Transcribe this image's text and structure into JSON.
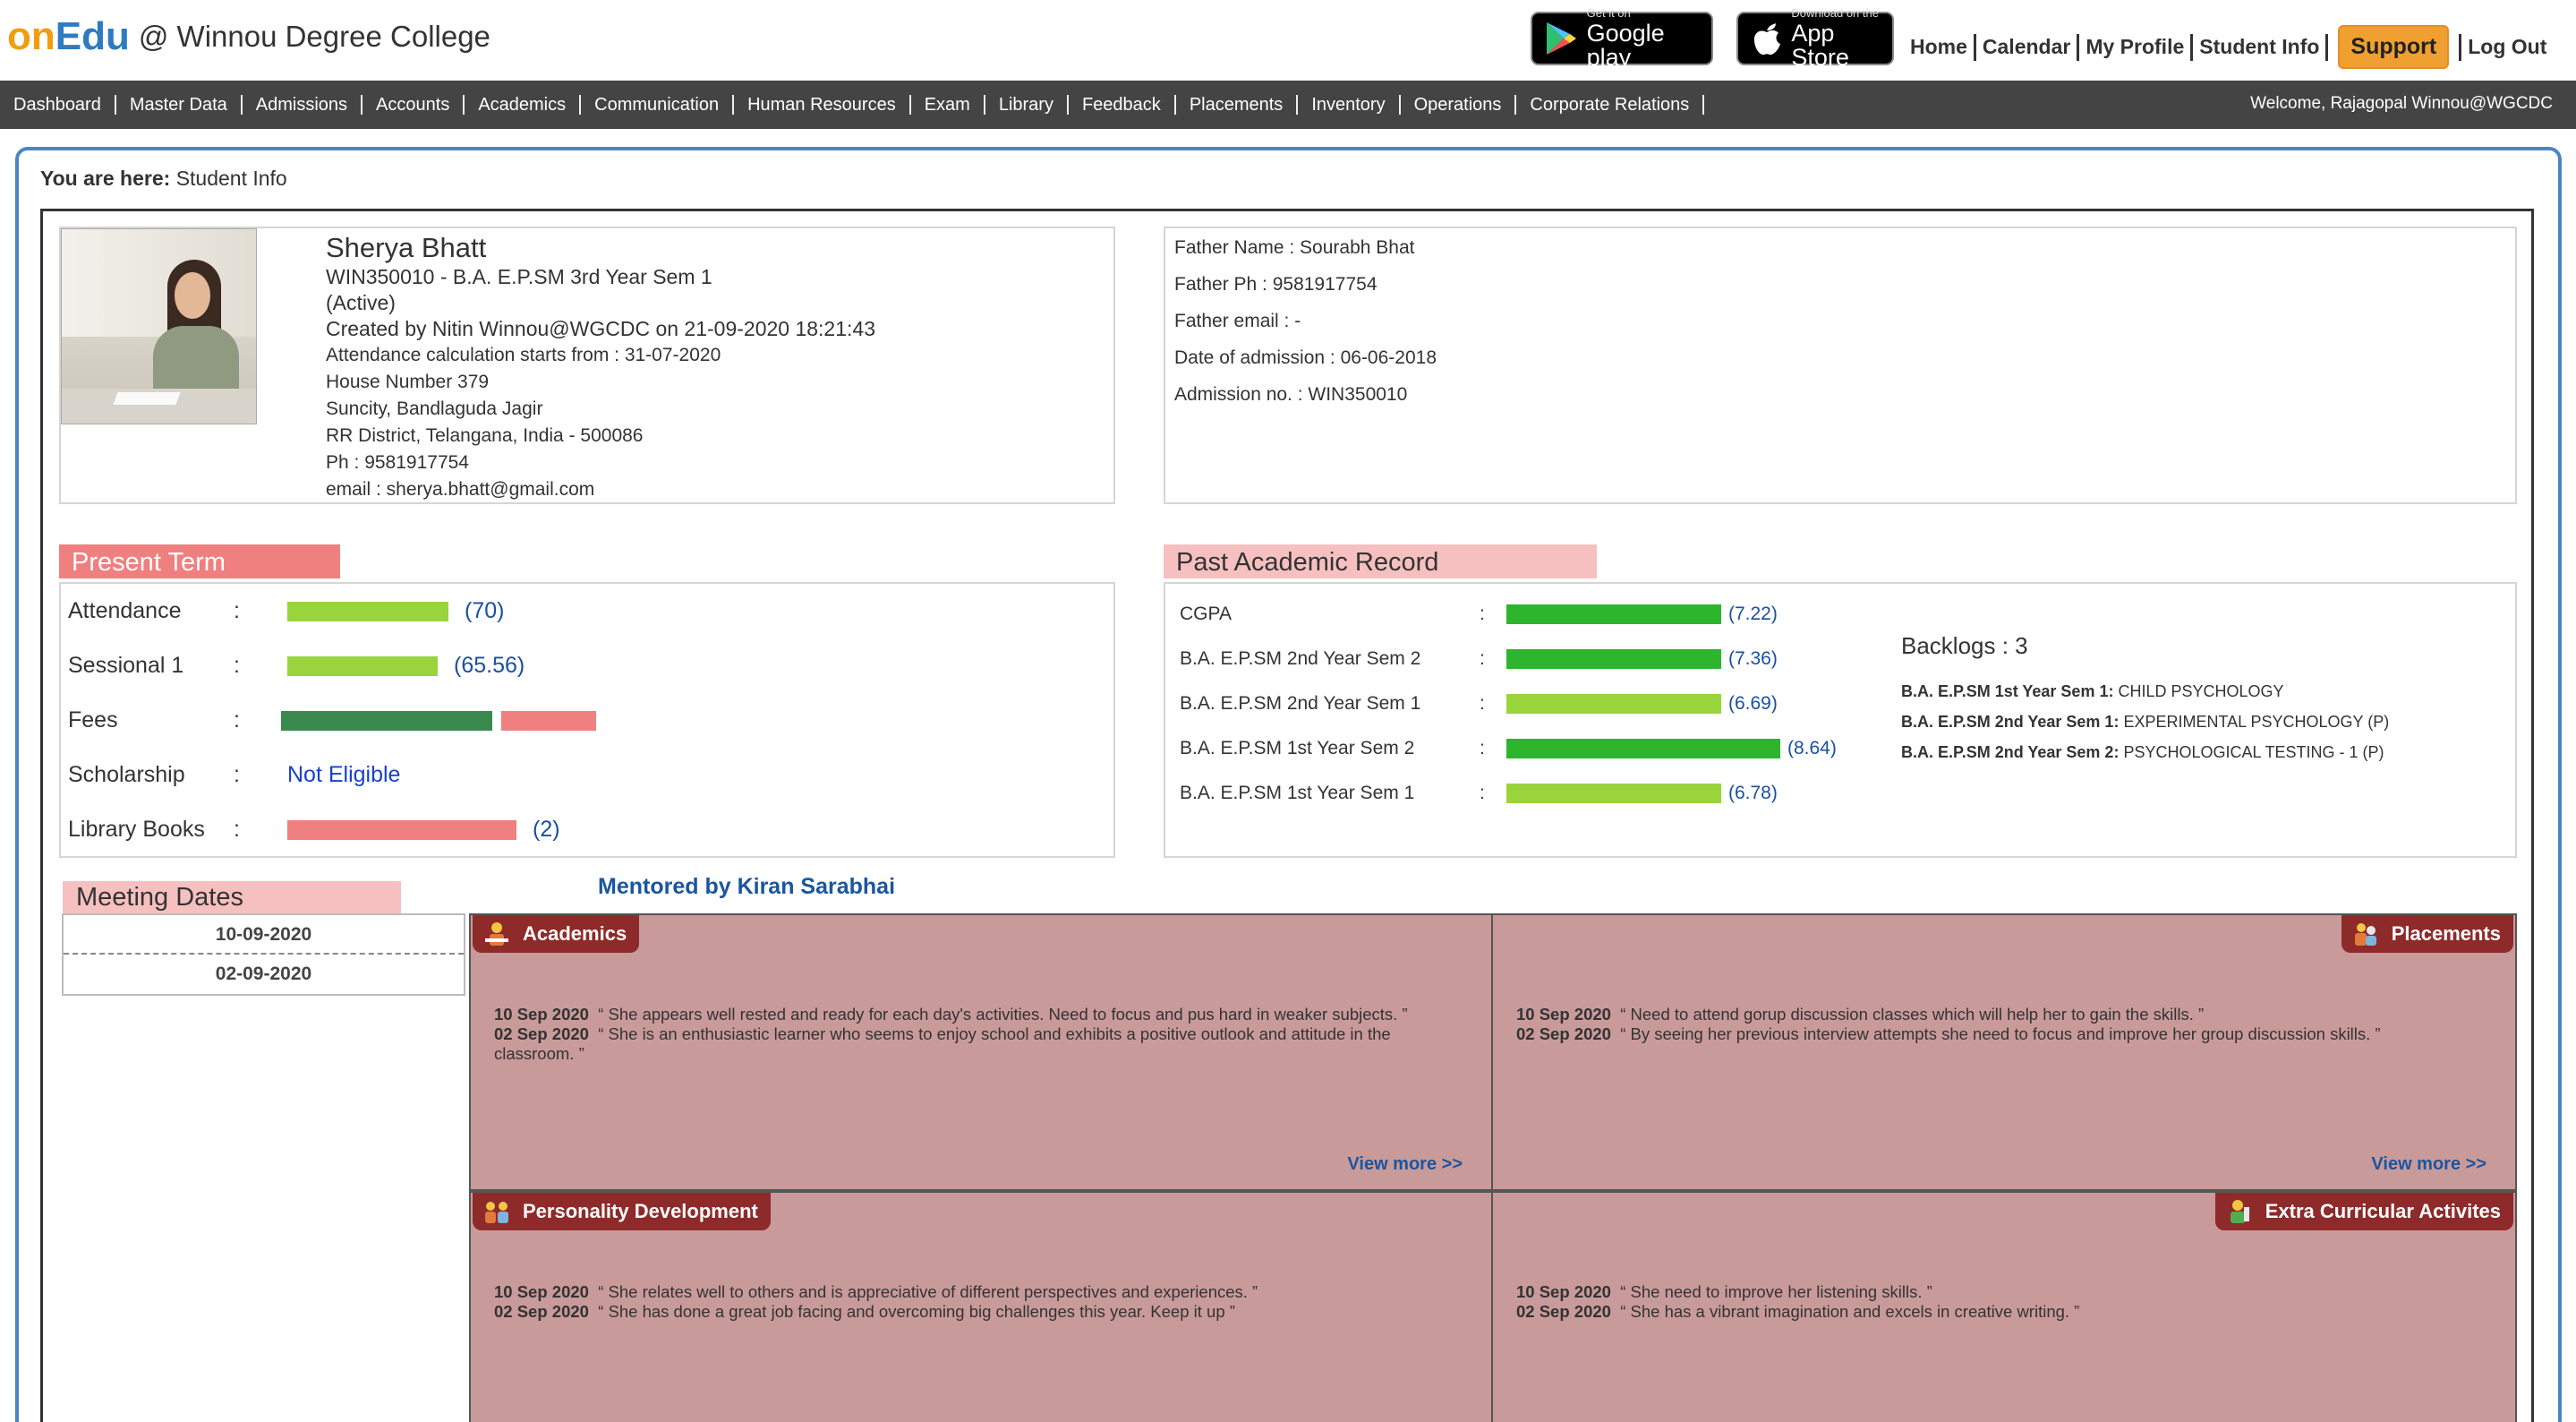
{
  "header": {
    "brand_on": "on",
    "brand_edu": "Edu",
    "brand_college": "@ Winnou Degree College",
    "gplay_small": "Get it on",
    "gplay_big": "Google play",
    "apple_small": "Download on the",
    "apple_big": "App Store",
    "links": {
      "home": "Home",
      "calendar": "Calendar",
      "profile": "My Profile",
      "student_info": "Student Info",
      "support": "Support",
      "logout": "Log Out"
    }
  },
  "nav": {
    "items": [
      "Dashboard",
      "Master Data",
      "Admissions",
      "Accounts",
      "Academics",
      "Communication",
      "Human Resources",
      "Exam",
      "Library",
      "Feedback",
      "Placements",
      "Inventory",
      "Operations",
      "Corporate Relations"
    ],
    "welcome": "Welcome, Rajagopal Winnou@WGCDC"
  },
  "breadcrumb": {
    "label": "You are here:",
    "page": "Student Info"
  },
  "student": {
    "name": "Sherya Bhatt",
    "program": "WIN350010 - B.A. E.P.SM 3rd Year Sem 1",
    "status": "(Active)",
    "created": "Created by Nitin Winnou@WGCDC on 21-09-2020 18:21:43",
    "attendance_start": "Attendance calculation starts from : 31-07-2020",
    "addr1": "House Number 379",
    "addr2": "Suncity, Bandlaguda Jagir",
    "addr3": "RR District, Telangana, India - 500086",
    "phone": "Ph : 9581917754",
    "email": "email : sherya.bhatt@gmail.com"
  },
  "parent": {
    "father_name": "Father Name : Sourabh Bhat",
    "father_ph": "Father Ph : 9581917754",
    "father_email": "Father email : -",
    "doa": "Date of admission : 06-06-2018",
    "adm_no": "Admission no. : WIN350010"
  },
  "present_term": {
    "title": "Present Term",
    "colon": ":",
    "attendance": {
      "label": "Attendance",
      "value": "(70)",
      "level": 70
    },
    "sessional": {
      "label": "Sessional 1",
      "value": "(65.56)",
      "level": 65.56
    },
    "fees": {
      "label": "Fees"
    },
    "scholarship": {
      "label": "Scholarship",
      "value": "Not Eligible"
    },
    "library": {
      "label": "Library Books",
      "value": "(2)"
    }
  },
  "past_record": {
    "title": "Past Academic Record",
    "colon": ":",
    "rows": [
      {
        "label": "CGPA",
        "value": "(7.22)",
        "color": "#2db52d"
      },
      {
        "label": "B.A. E.P.SM 2nd Year Sem 2",
        "value": "(7.36)",
        "color": "#2db52d"
      },
      {
        "label": "B.A. E.P.SM 2nd Year Sem 1",
        "value": "(6.69)",
        "color": "#9ad43c"
      },
      {
        "label": "B.A. E.P.SM 1st Year Sem 2",
        "value": "(8.64)",
        "color": "#2db52d"
      },
      {
        "label": "B.A. E.P.SM 1st Year Sem 1",
        "value": "(6.78)",
        "color": "#9ad43c"
      }
    ],
    "backlogs_title": "Backlogs : 3",
    "backlogs": [
      {
        "sem": "B.A. E.P.SM 1st Year Sem 1:",
        "subject": "CHILD PSYCHOLOGY"
      },
      {
        "sem": "B.A. E.P.SM 2nd Year Sem 1:",
        "subject": "EXPERIMENTAL PSYCHOLOGY (P)"
      },
      {
        "sem": "B.A. E.P.SM 2nd Year Sem 2:",
        "subject": "PSYCHOLOGICAL TESTING - 1 (P)"
      }
    ]
  },
  "meetings": {
    "title": "Meeting Dates",
    "dates": [
      "10-09-2020",
      "02-09-2020"
    ]
  },
  "mentor": "Mentored by Kiran Sarabhai",
  "panels": {
    "academics": {
      "title": "Academics",
      "n1_date": "10 Sep 2020",
      "n1_text": "“ She appears well rested and ready for each day's activities. Need to focus and pus hard in weaker subjects. ”",
      "n2_date": "02 Sep 2020",
      "n2_text": "“ She is an enthusiastic learner who seems to enjoy school and exhibits a positive outlook and attitude in the classroom. ”",
      "view_more": "View more >>"
    },
    "placements": {
      "title": "Placements",
      "n1_date": "10 Sep 2020",
      "n1_text": "“ Need to attend gorup discussion classes which will help her to gain the skills. ”",
      "n2_date": "02 Sep 2020",
      "n2_text": "“ By seeing her previous interview attempts she need to focus and improve her group discussion skills. ”",
      "view_more": "View more >>"
    },
    "personality": {
      "title": "Personality Development",
      "n1_date": "10 Sep 2020",
      "n1_text": "“ She relates well to others and is appreciative of different perspectives and experiences. ”",
      "n2_date": "02 Sep 2020",
      "n2_text": "“ She has done a great job facing and overcoming big challenges this year. Keep it up ”"
    },
    "extra": {
      "title": "Extra Curricular Activites",
      "n1_date": "10 Sep 2020",
      "n1_text": "“ She need to improve her listening skills. ”",
      "n2_date": "02 Sep 2020",
      "n2_text": "“ She has a vibrant imagination and excels in creative writing. ”"
    }
  }
}
